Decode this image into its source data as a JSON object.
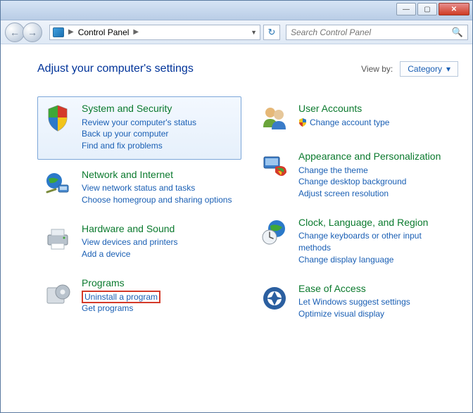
{
  "titlebar": {
    "minimize": "—",
    "maximize": "▢",
    "close": "✕"
  },
  "toolbar": {
    "back": "←",
    "forward": "→",
    "breadcrumb": "Control Panel",
    "breadcrumb_arrow": "▶",
    "addr_dropdown": "▼",
    "refresh": "↻",
    "search_placeholder": "Search Control Panel",
    "search_icon": "🔍"
  },
  "header": {
    "heading": "Adjust your computer's settings",
    "viewby_label": "View by:",
    "viewby_value": "Category",
    "viewby_caret": "▾"
  },
  "left": [
    {
      "title": "System and Security",
      "links": [
        "Review your computer's status",
        "Back up your computer",
        "Find and fix problems"
      ]
    },
    {
      "title": "Network and Internet",
      "links": [
        "View network status and tasks",
        "Choose homegroup and sharing options"
      ]
    },
    {
      "title": "Hardware and Sound",
      "links": [
        "View devices and printers",
        "Add a device"
      ]
    },
    {
      "title": "Programs",
      "links": [
        "Uninstall a program",
        "Get programs"
      ]
    }
  ],
  "right": [
    {
      "title": "User Accounts",
      "links": [
        "Change account type"
      ]
    },
    {
      "title": "Appearance and Personalization",
      "links": [
        "Change the theme",
        "Change desktop background",
        "Adjust screen resolution"
      ]
    },
    {
      "title": "Clock, Language, and Region",
      "links": [
        "Change keyboards or other input methods",
        "Change display language"
      ]
    },
    {
      "title": "Ease of Access",
      "links": [
        "Let Windows suggest settings",
        "Optimize visual display"
      ]
    }
  ]
}
